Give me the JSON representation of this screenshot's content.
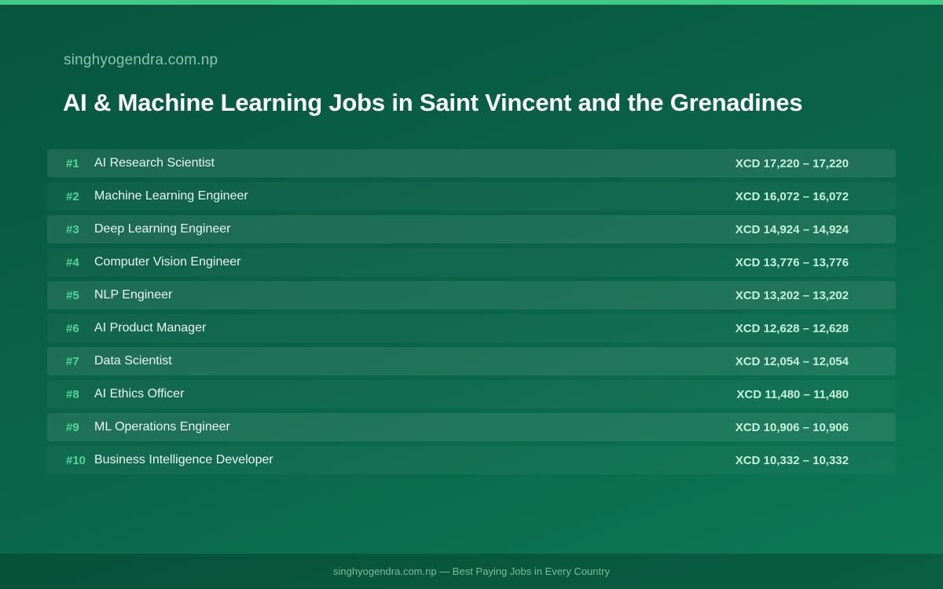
{
  "header": {
    "site_name": "singhyogendra.com.np",
    "title": "AI & Machine Learning Jobs in Saint Vincent and the Grenadines"
  },
  "jobs": [
    {
      "rank": "#1",
      "title": "AI Research Scientist",
      "salary": "XCD 17,220 – 17,220"
    },
    {
      "rank": "#2",
      "title": "Machine Learning Engineer",
      "salary": "XCD 16,072 – 16,072"
    },
    {
      "rank": "#3",
      "title": "Deep Learning Engineer",
      "salary": "XCD 14,924 – 14,924"
    },
    {
      "rank": "#4",
      "title": "Computer Vision Engineer",
      "salary": "XCD 13,776 – 13,776"
    },
    {
      "rank": "#5",
      "title": "NLP Engineer",
      "salary": "XCD 13,202 – 13,202"
    },
    {
      "rank": "#6",
      "title": "AI Product Manager",
      "salary": "XCD 12,628 – 12,628"
    },
    {
      "rank": "#7",
      "title": "Data Scientist",
      "salary": "XCD 12,054 – 12,054"
    },
    {
      "rank": "#8",
      "title": "AI Ethics Officer",
      "salary": "XCD 11,480 – 11,480"
    },
    {
      "rank": "#9",
      "title": "ML Operations Engineer",
      "salary": "XCD 10,906 – 10,906"
    },
    {
      "rank": "#10",
      "title": "Business Intelligence Developer",
      "salary": "XCD 10,332 – 10,332"
    }
  ],
  "footer": {
    "text": "singhyogendra.com.np — Best Paying Jobs in Every Country"
  },
  "colors": {
    "background": "#0a6649",
    "accent": "#3ecb86",
    "rank": "#4fd699"
  }
}
